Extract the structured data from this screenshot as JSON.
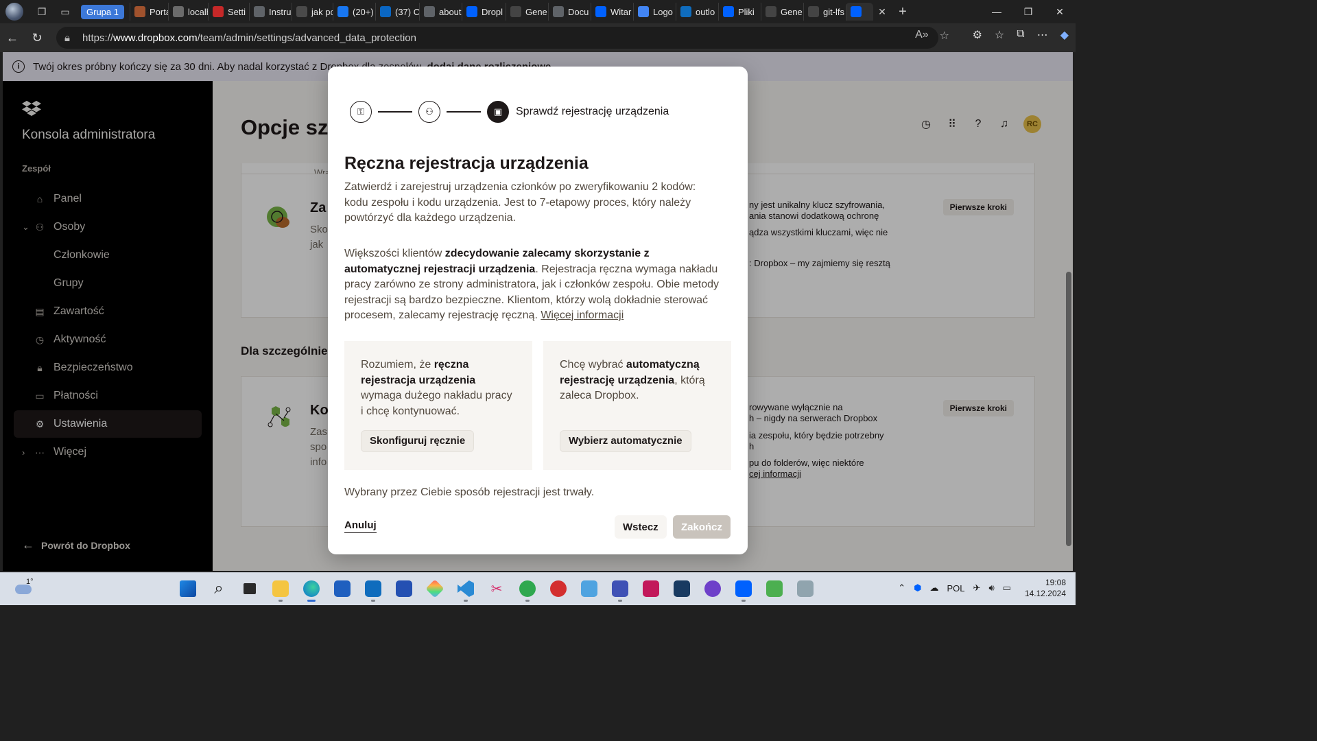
{
  "browser": {
    "group_label": "Grupa 1",
    "tabs": [
      {
        "label": "Porta",
        "color": "#a0522d"
      },
      {
        "label": "localh",
        "color": "#6b6b6b"
      },
      {
        "label": "Setti",
        "color": "#c62828"
      },
      {
        "label": "Instru",
        "color": "#5f6368"
      },
      {
        "label": "jak pc",
        "color": "#4a4a4a"
      },
      {
        "label": "(20+)",
        "color": "#1877f2"
      },
      {
        "label": "(37) C",
        "color": "#0a66c2"
      },
      {
        "label": "about",
        "color": "#5f6368"
      },
      {
        "label": "Dropl",
        "color": "#0061fe"
      },
      {
        "label": "Gene",
        "color": "#444"
      },
      {
        "label": "Docu",
        "color": "#5f6368"
      },
      {
        "label": "Witar",
        "color": "#0061fe"
      },
      {
        "label": "Logo",
        "color": "#4285f4"
      },
      {
        "label": "outlo",
        "color": "#0f6cbd"
      },
      {
        "label": "Pliki",
        "color": "#0061fe"
      },
      {
        "label": "Gene",
        "color": "#444"
      },
      {
        "label": "git-lfs",
        "color": "#444"
      },
      {
        "label": "",
        "color": "#0061fe"
      }
    ],
    "url_prefix": "https://",
    "url_host": "www.dropbox.com",
    "url_path": "/team/admin/settings/advanced_data_protection"
  },
  "banner": {
    "text": "Twój okres próbny kończy się za 30 dni. Aby nadal korzystać z Dropbox dla zespołów,",
    "link": "dodaj dane rozliczeniowe."
  },
  "sidebar": {
    "title": "Konsola administratora",
    "section": "Zespół",
    "items": [
      {
        "label": "Panel",
        "icon": "home-icon"
      },
      {
        "label": "Osoby",
        "icon": "people-icon"
      },
      {
        "label": "Członkowie"
      },
      {
        "label": "Grupy"
      },
      {
        "label": "Zawartość",
        "icon": "folder-icon"
      },
      {
        "label": "Aktywność",
        "icon": "activity-icon"
      },
      {
        "label": "Bezpieczeństwo",
        "icon": "lock-icon"
      },
      {
        "label": "Płatności",
        "icon": "billing-icon"
      },
      {
        "label": "Ustawienia",
        "icon": "gear-icon"
      },
      {
        "label": "Więcej",
        "icon": "more-icon"
      }
    ],
    "back": "Powrót do Dropbox"
  },
  "main": {
    "title": "Opcje sz",
    "cut_text": "Wra",
    "section_heading": "Dla szczególnie",
    "card1": {
      "heading": "Za",
      "sub1": "Sko",
      "sub2": "jak",
      "text1": "ny jest unikalny klucz szyfrowania,",
      "text2": "ania stanowi dodatkową ochronę",
      "text3": "ądza wszystkimi kluczami, więc nie",
      "text4": ": Dropbox – my zajmiemy się resztą",
      "button": "Pierwsze kroki"
    },
    "card2": {
      "heading": "Ko",
      "sub1": "Zas",
      "sub2": "spo",
      "sub3": "info",
      "text1": "rowywane wyłącznie na",
      "text2": "h – nigdy na serwerach Dropbox",
      "text3": "ia zespołu, który będzie potrzebny",
      "text4": "h",
      "text5": "pu do folderów, więc niektóre",
      "link": "cej informacji",
      "button": "Pierwsze kroki"
    },
    "avatar_initials": "RC"
  },
  "modal": {
    "step_current_label": "Sprawdź rejestrację urządzenia",
    "title": "Ręczna rejestracja urządzenia",
    "para1": "Zatwierdź i zarejestruj urządzenia członków po zweryfikowaniu 2 kodów: kodu zespołu i kodu urządzenia. Jest to 7-etapowy proces, który należy powtórzyć dla każdego urządzenia.",
    "para2_a": "Większości klientów ",
    "para2_b": "zdecydowanie zalecamy skorzystanie z automatycznej rejestracji urządzenia",
    "para2_c": ". Rejestracja ręczna wymaga nakładu pracy zarówno ze strony administratora, jak i członków zespołu. Obie metody rejestracji są bardzo bezpieczne. Klientom, którzy wolą dokładnie sterować procesem, zalecamy rejestrację ręczną. ",
    "para2_link": "Więcej informacji",
    "choice_manual_a": "Rozumiem, że ",
    "choice_manual_b": "ręczna rejestracja urządzenia",
    "choice_manual_c": " wymaga dużego nakładu pracy i chcę kontynuować.",
    "choice_manual_button": "Skonfiguruj ręcznie",
    "choice_auto_a": "Chcę wybrać ",
    "choice_auto_b": "automatyczną rejestrację urządzenia",
    "choice_auto_c": ", którą zaleca Dropbox.",
    "choice_auto_button": "Wybierz automatycznie",
    "note": "Wybrany przez Ciebie sposób rejestracji jest trwały.",
    "cancel": "Anuluj",
    "back": "Wstecz",
    "finish": "Zakończ"
  },
  "taskbar": {
    "temperature": "1°",
    "language": "POL",
    "time": "19:08",
    "date": "14.12.2024"
  }
}
